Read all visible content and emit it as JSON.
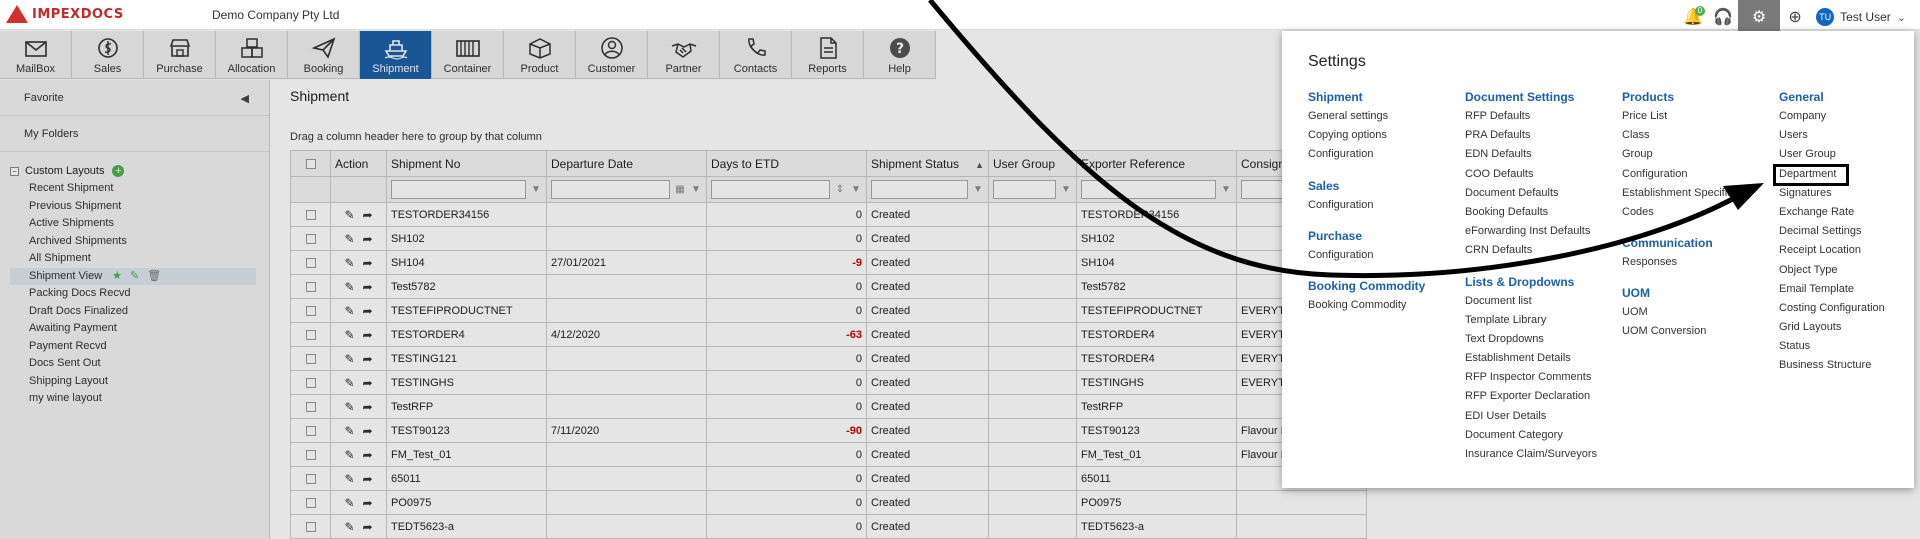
{
  "header": {
    "logo_text": "IMPEXDOCS",
    "company": "Demo Company Pty Ltd",
    "notification_count": "0",
    "user_initials": "TU",
    "user_name": "Test User"
  },
  "modules": [
    {
      "label": "MailBox",
      "icon": "mailbox-icon"
    },
    {
      "label": "Sales",
      "icon": "dollar-icon"
    },
    {
      "label": "Purchase",
      "icon": "store-icon"
    },
    {
      "label": "Allocation",
      "icon": "boxes-icon"
    },
    {
      "label": "Booking",
      "icon": "paper-plane-icon"
    },
    {
      "label": "Shipment",
      "icon": "ship-icon"
    },
    {
      "label": "Container",
      "icon": "container-icon"
    },
    {
      "label": "Product",
      "icon": "package-icon"
    },
    {
      "label": "Customer",
      "icon": "customer-icon"
    },
    {
      "label": "Partner",
      "icon": "handshake-icon"
    },
    {
      "label": "Contacts",
      "icon": "phone-icon"
    },
    {
      "label": "Reports",
      "icon": "report-icon"
    },
    {
      "label": "Help",
      "icon": "help-icon"
    }
  ],
  "active_module": "Shipment",
  "sidebar": {
    "favorite": "Favorite",
    "my_folders": "My Folders",
    "custom_layouts": "Custom Layouts",
    "layouts": [
      "Recent Shipment",
      "Previous Shipment",
      "Active Shipments",
      "Archived Shipments",
      "All Shipment",
      "Shipment View",
      "Packing Docs Recvd",
      "Draft Docs Finalized",
      "Awaiting Payment",
      "Payment Recvd",
      "Docs Sent Out",
      "Shipping Layout",
      "my wine layout"
    ],
    "selected_layout": "Shipment View"
  },
  "main": {
    "title": "Shipment",
    "group_hint": "Drag a column header here to group by that column",
    "columns": [
      "Action",
      "Shipment No",
      "Departure Date",
      "Days to ETD",
      "Shipment Status",
      "User Group",
      "Exporter Reference",
      "Consign"
    ],
    "rows": [
      {
        "no": "TESTORDER34156",
        "date": "",
        "days": "0",
        "status": "Created",
        "group": "",
        "ref": "TESTORDER34156",
        "consign": ""
      },
      {
        "no": "SH102",
        "date": "",
        "days": "0",
        "status": "Created",
        "group": "",
        "ref": "SH102",
        "consign": ""
      },
      {
        "no": "SH104",
        "date": "27/01/2021",
        "days": "-9",
        "status": "Created",
        "group": "",
        "ref": "SH104",
        "consign": ""
      },
      {
        "no": "Test5782",
        "date": "",
        "days": "0",
        "status": "Created",
        "group": "",
        "ref": "Test5782",
        "consign": ""
      },
      {
        "no": "TESTEFIPRODUCTNET",
        "date": "",
        "days": "0",
        "status": "Created",
        "group": "",
        "ref": "TESTEFIPRODUCTNET",
        "consign": "EVERYTH"
      },
      {
        "no": "TESTORDER4",
        "date": "4/12/2020",
        "days": "-63",
        "status": "Created",
        "group": "",
        "ref": "TESTORDER4",
        "consign": "EVERYTH"
      },
      {
        "no": "TESTING121",
        "date": "",
        "days": "0",
        "status": "Created",
        "group": "",
        "ref": "TESTORDER4",
        "consign": "EVERYTH"
      },
      {
        "no": "TESTINGHS",
        "date": "",
        "days": "0",
        "status": "Created",
        "group": "",
        "ref": "TESTINGHS",
        "consign": "EVERYTH"
      },
      {
        "no": "TestRFP",
        "date": "",
        "days": "0",
        "status": "Created",
        "group": "",
        "ref": "TestRFP",
        "consign": ""
      },
      {
        "no": "TEST90123",
        "date": "7/11/2020",
        "days": "-90",
        "status": "Created",
        "group": "",
        "ref": "TEST90123",
        "consign": "Flavour N"
      },
      {
        "no": "FM_Test_01",
        "date": "",
        "days": "0",
        "status": "Created",
        "group": "",
        "ref": "FM_Test_01",
        "consign": "Flavour N"
      },
      {
        "no": "65011",
        "date": "",
        "days": "0",
        "status": "Created",
        "group": "",
        "ref": "65011",
        "consign": ""
      },
      {
        "no": "PO0975",
        "date": "",
        "days": "0",
        "status": "Created",
        "group": "",
        "ref": "PO0975",
        "consign": ""
      },
      {
        "no": "TEDT5623-a",
        "date": "",
        "days": "0",
        "status": "Created",
        "group": "",
        "ref": "TEDT5623-a",
        "consign": ""
      }
    ]
  },
  "settings": {
    "title": "Settings",
    "columns": [
      [
        {
          "heading": "Shipment",
          "links": [
            "General settings",
            "Copying options",
            "Configuration"
          ]
        },
        {
          "heading": "Sales",
          "links": [
            "Configuration"
          ]
        },
        {
          "heading": "Purchase",
          "links": [
            "Configuration"
          ]
        },
        {
          "heading": "Booking Commodity",
          "links": [
            "Booking Commodity"
          ]
        }
      ],
      [
        {
          "heading": "Document Settings",
          "links": [
            "RFP Defaults",
            "PRA Defaults",
            "EDN Defaults",
            "COO Defaults",
            "Document Defaults",
            "Booking Defaults",
            "eForwarding Inst Defaults",
            "CRN Defaults"
          ]
        },
        {
          "heading": "Lists & Dropdowns",
          "links": [
            "Document list",
            "Template Library",
            "Text Dropdowns",
            "Establishment Details",
            "RFP Inspector Comments",
            "RFP Exporter Declaration",
            "EDI User Details",
            "Document Category",
            "Insurance Claim/Surveyors"
          ]
        }
      ],
      [
        {
          "heading": "Products",
          "links": [
            "Price List",
            "Class",
            "Group",
            "Configuration",
            "Establishment Specific Codes"
          ]
        },
        {
          "heading": "Communication",
          "links": [
            "Responses"
          ]
        },
        {
          "heading": "UOM",
          "links": [
            "UOM",
            "UOM Conversion"
          ]
        }
      ],
      [
        {
          "heading": "General",
          "links": [
            "Company",
            "Users",
            "User Group",
            "Department",
            "Signatures",
            "Exchange Rate",
            "Decimal Settings",
            "Receipt Location",
            "Object Type",
            "Email Template",
            "Costing Configuration",
            "Grid Layouts",
            "Status",
            "Business Structure"
          ]
        }
      ]
    ],
    "highlighted_link": "Department"
  }
}
